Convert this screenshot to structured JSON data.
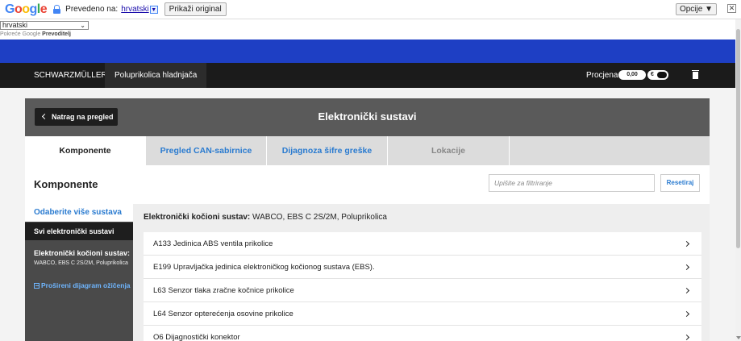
{
  "translate_bar": {
    "logo": [
      "G",
      "o",
      "o",
      "g",
      "l",
      "e"
    ],
    "translated_to_label": "Prevedeno na:",
    "language_link": "hrvatski",
    "show_original": "Prikaži original",
    "options": "Opcije ▼",
    "close": "✕"
  },
  "language": {
    "selected": "hrvatski",
    "powered_prefix": "Pokreće",
    "powered_google": "Google",
    "powered_suffix": "Prevoditelj"
  },
  "header": {
    "brand": "SCHWARZMÜLLER",
    "model": "Poluprikolica hladnjača",
    "estimate_label": "Procjena",
    "estimate_value": "0,00",
    "currency": "€"
  },
  "card": {
    "back_label": "Natrag na pregled",
    "title": "Elektronički sustavi"
  },
  "tabs": [
    {
      "label": "Komponente",
      "state": "active"
    },
    {
      "label": "Pregled CAN-sabirnice",
      "state": "normal"
    },
    {
      "label": "Dijagnoza šifre greške",
      "state": "normal"
    },
    {
      "label": "Lokacije",
      "state": "disabled"
    }
  ],
  "panel": {
    "title": "Komponente",
    "filter_placeholder": "Upišite za filtriranje",
    "reset_label": "Resetiraj"
  },
  "sidebar": {
    "select_multiple": "Odaberite više sustava",
    "all_systems": "Svi elektronički sustavi",
    "system_title": "Elektronički kočioni sustav:",
    "system_sub": "WABCO, EBS C 2S/2M, Poluprikolica",
    "extended_diagram": "Prošireni dijagram ožičenja"
  },
  "content": {
    "heading_bold": "Elektronički kočioni sustav:",
    "heading_rest": " WABCO, EBS C 2S/2M, Poluprikolica",
    "components": [
      "A133 Jedinica ABS ventila prikolice",
      "E199 Upravljačka jedinica elektroničkog kočionog sustava (EBS).",
      "L63 Senzor tlaka zračne kočnice prikolice",
      "L64 Senzor opterećenja osovine prikolice",
      "O6 Dijagnostički konektor"
    ]
  },
  "colors": {
    "blue_band": "#1e3fc4",
    "nav_dark": "#1b1b1b",
    "card_head": "#5a5a5a",
    "link_blue": "#2a7bd0"
  }
}
